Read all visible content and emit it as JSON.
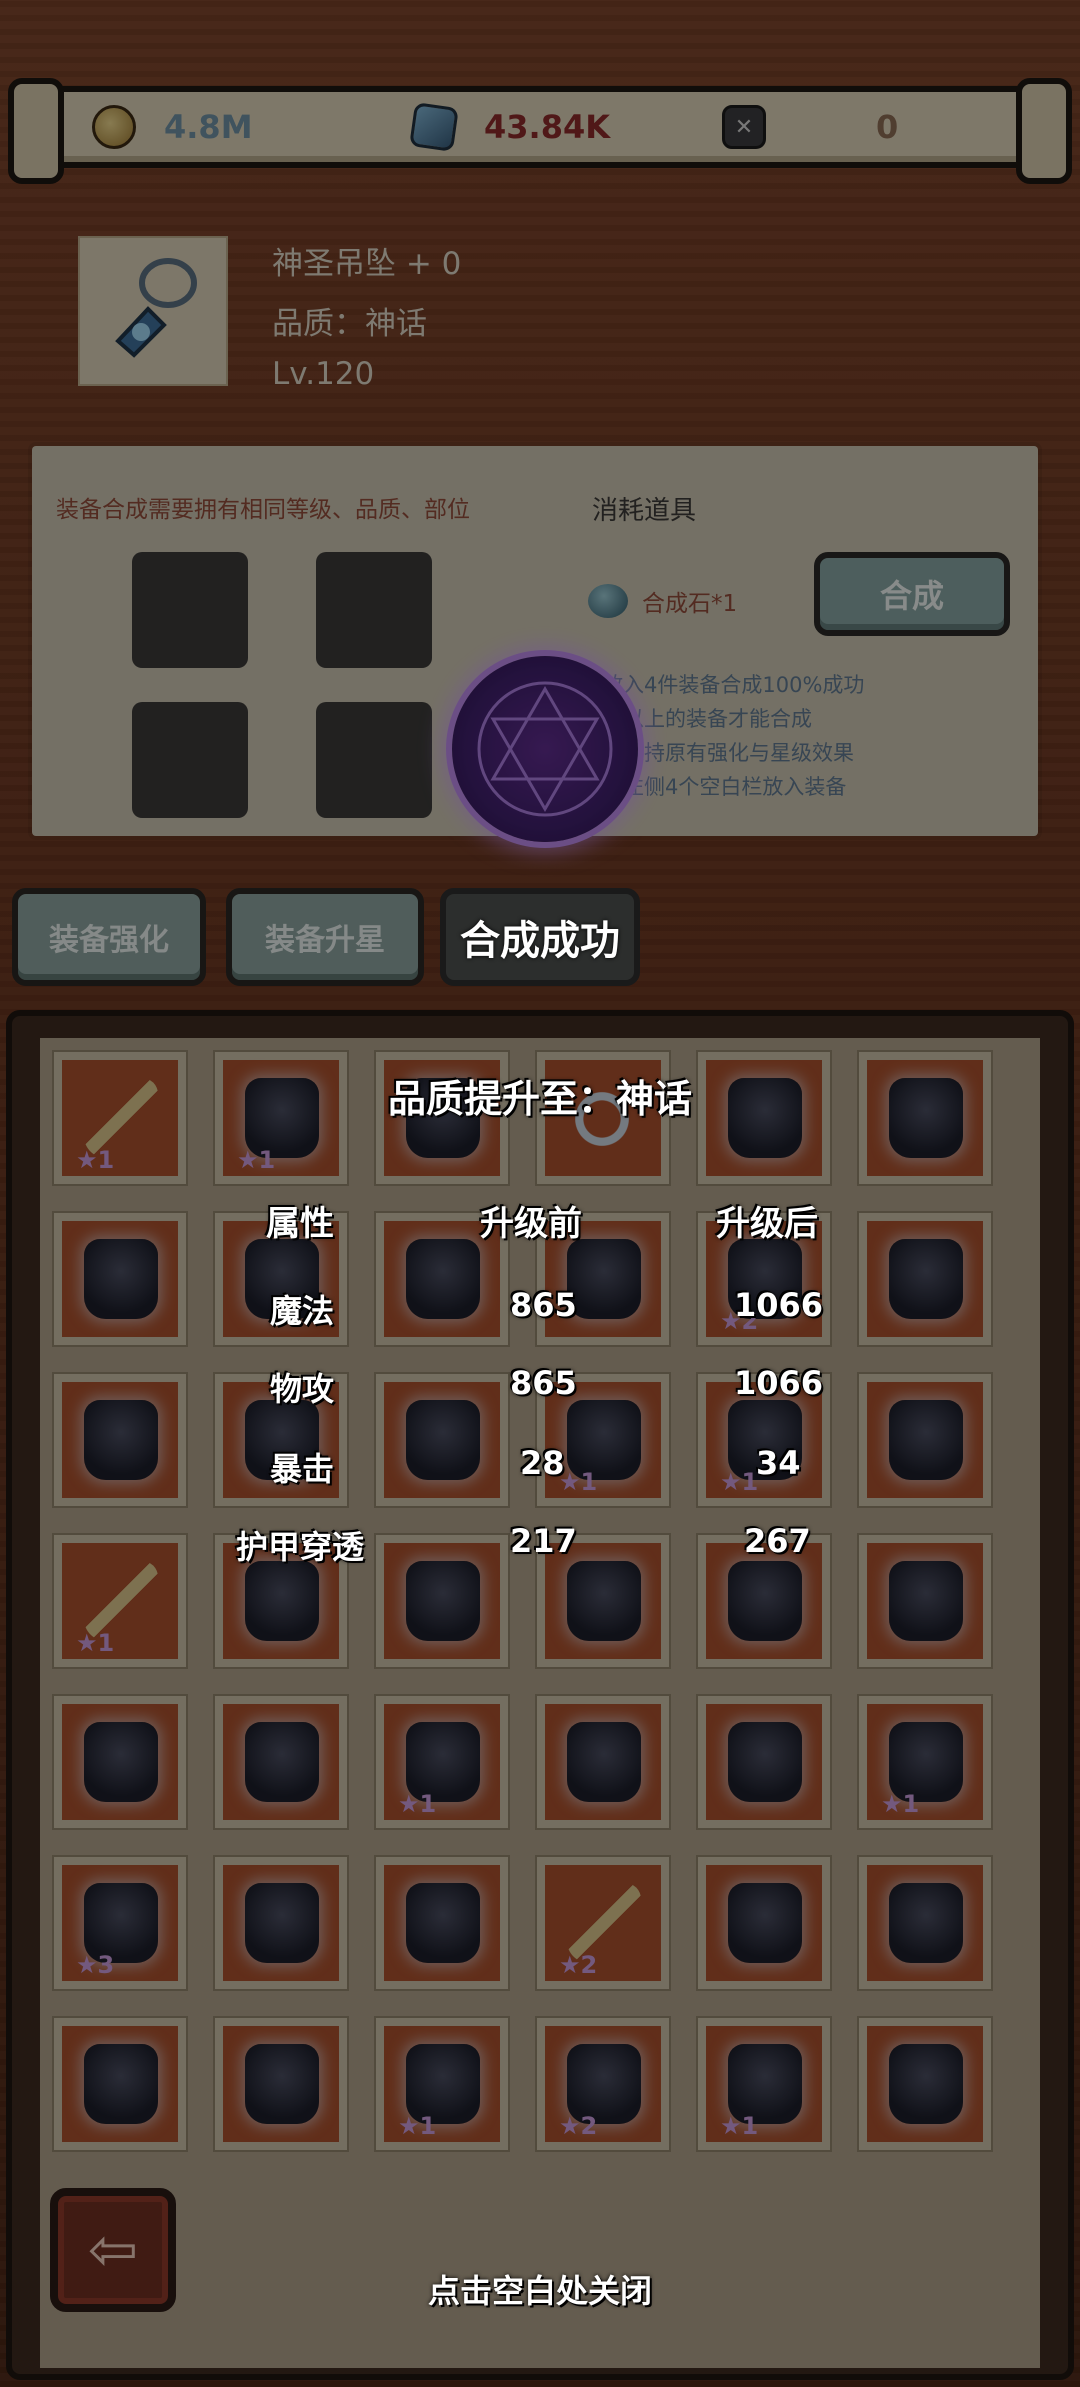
{
  "currencies": [
    {
      "icon": "gold-coin-icon",
      "value": "4.8M"
    },
    {
      "icon": "blue-crystal-icon",
      "value": "43.84K"
    },
    {
      "icon": "dark-rune-icon",
      "value": "0"
    }
  ],
  "item": {
    "name": "神圣吊坠 + 0",
    "quality": "品质：神话",
    "level": "Lv.120",
    "icon": "pendant-icon"
  },
  "synthesis": {
    "tip": "装备合成需要拥有相同等级、品质、部位",
    "consume_title": "消耗道具",
    "material": "合成石*1",
    "button": "合成",
    "rules": [
      "放入4件装备合成100%成功",
      "及以上的装备才能合成",
      "后保持原有强化与星级效果",
      "击左侧4个空白栏放入装备"
    ]
  },
  "tabs": {
    "enhance": "装备强化",
    "star_up": "装备升星",
    "success": "合成成功"
  },
  "result": {
    "title": "品质提升至：神话",
    "headers": {
      "attr": "属性",
      "before": "升级前",
      "after": "升级后"
    },
    "rows": [
      {
        "attr": "魔法",
        "before": "865",
        "after": "1066"
      },
      {
        "attr": "物攻",
        "before": "865",
        "after": "1066"
      },
      {
        "attr": "暴击",
        "before": "28",
        "after": "34"
      },
      {
        "attr": "护甲穿透",
        "before": "217",
        "after": "267"
      }
    ],
    "close_hint": "点击空白处关闭"
  },
  "inventory": [
    {
      "type": "sword",
      "stars": "★1"
    },
    {
      "type": "armor",
      "stars": "★1"
    },
    {
      "type": "glove",
      "stars": ""
    },
    {
      "type": "ring",
      "stars": ""
    },
    {
      "type": "armor",
      "stars": ""
    },
    {
      "type": "hat",
      "stars": ""
    },
    {
      "type": "boot",
      "stars": ""
    },
    {
      "type": "hat",
      "stars": ""
    },
    {
      "type": "hat",
      "stars": ""
    },
    {
      "type": "boot",
      "stars": ""
    },
    {
      "type": "boot",
      "stars": "★2"
    },
    {
      "type": "boot",
      "stars": ""
    },
    {
      "type": "glove",
      "stars": ""
    },
    {
      "type": "glove",
      "stars": ""
    },
    {
      "type": "boot",
      "stars": ""
    },
    {
      "type": "armor",
      "stars": "★1"
    },
    {
      "type": "armor",
      "stars": "★1"
    },
    {
      "type": "armor",
      "stars": ""
    },
    {
      "type": "sword",
      "stars": "★1"
    },
    {
      "type": "glove",
      "stars": ""
    },
    {
      "type": "glove",
      "stars": ""
    },
    {
      "type": "boot",
      "stars": ""
    },
    {
      "type": "boot",
      "stars": ""
    },
    {
      "type": "boot",
      "stars": ""
    },
    {
      "type": "hat",
      "stars": ""
    },
    {
      "type": "glove",
      "stars": ""
    },
    {
      "type": "glove",
      "stars": "★1"
    },
    {
      "type": "armor",
      "stars": ""
    },
    {
      "type": "hat",
      "stars": ""
    },
    {
      "type": "glove",
      "stars": "★1"
    },
    {
      "type": "armor",
      "stars": "★3"
    },
    {
      "type": "boot",
      "stars": ""
    },
    {
      "type": "hat",
      "stars": ""
    },
    {
      "type": "sword",
      "stars": "★2"
    },
    {
      "type": "glove",
      "stars": ""
    },
    {
      "type": "hat",
      "stars": ""
    },
    {
      "type": "glove",
      "stars": ""
    },
    {
      "type": "glove",
      "stars": ""
    },
    {
      "type": "glove",
      "stars": "★1"
    },
    {
      "type": "hat",
      "stars": "★2"
    },
    {
      "type": "armor",
      "stars": "★1"
    },
    {
      "type": "glove",
      "stars": ""
    }
  ]
}
